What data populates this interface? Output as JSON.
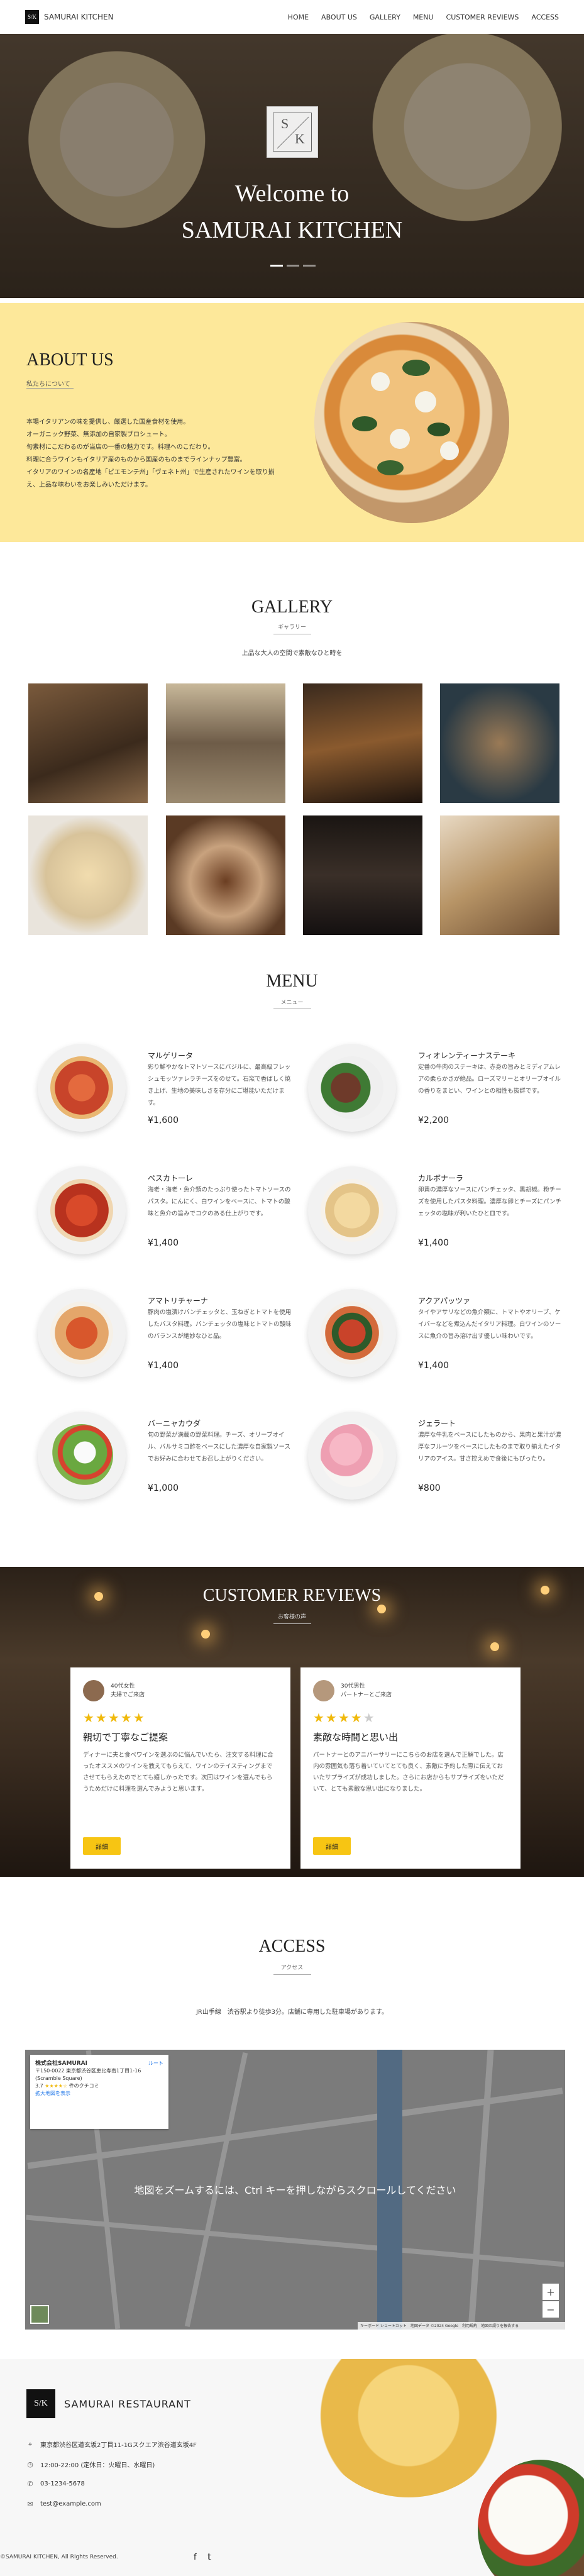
{
  "header": {
    "logo_text": "S/K",
    "brand": "SAMURAI KITCHEN",
    "nav": [
      "HOME",
      "ABOUT US",
      "GALLERY",
      "MENU",
      "CUSTOMER REVIEWS",
      "ACCESS"
    ]
  },
  "hero": {
    "emblem_s": "S",
    "emblem_k": "K",
    "title_line1": "Welcome to",
    "title_line2": "SAMURAI KITCHEN"
  },
  "about": {
    "title": "ABOUT US",
    "subtitle": "私たちについて",
    "paragraphs": [
      "本場イタリアンの味を提供し、厳選した国産食材を使用。",
      "オーガニック野菜、無添加の自家製ブロシュート。",
      "旬素材にこだわるのが当店の一番の魅力です。料理へのこだわり。",
      "料理に合うワインもイタリア産のものから国産のものまでラインナップ豊富。",
      "イタリアのワインの名産地「ピエモンテ州」「ヴェネト州」で生産されたワインを取り揃え、上品な味わいをお楽しみいただけます。"
    ]
  },
  "gallery": {
    "title": "GALLERY",
    "subtitle": "ギャラリー",
    "description": "上品な大人の空間で素敵なひと時を"
  },
  "menu": {
    "title": "MENU",
    "subtitle": "メニュー",
    "items": [
      {
        "name": "マルゲリータ",
        "desc": "彩り鮮やかなトマトソースにバジルに、最高級フレッシュモッツァレラチーズをのせて。石窯で香ばしく焼き上げ、生地の美味しさを存分にご堪能いただけます。",
        "price": "¥1,600"
      },
      {
        "name": "フィオレンティーナステーキ",
        "desc": "定番の牛肉のステーキは、赤身の旨みとミディアムレアの柔らかさが絶品。ローズマリーとオリーブオイルの香りをまとい、ワインとの相性も抜群です。",
        "price": "¥2,200"
      },
      {
        "name": "ペスカトーレ",
        "desc": "海老・海老・魚介類のたっぷり使ったトマトソースのパスタ。にんにく、白ワインをベースに、トマトの酸味と魚介の旨みでコクのある仕上がりです。",
        "price": "¥1,400"
      },
      {
        "name": "カルボナーラ",
        "desc": "卵黄の濃厚なソースにパンチェッタ、黒胡椒。粉チーズを使用したパスタ料理。濃厚な卵とチーズにパンチェッタの塩味が利いたひと皿です。",
        "price": "¥1,400"
      },
      {
        "name": "アマトリチャーナ",
        "desc": "豚肉の塩漬けパンチェッタと、玉ねぎとトマトを使用したパスタ料理。パンチェッタの塩味とトマトの酸味のバランスが絶妙なひと品。",
        "price": "¥1,400"
      },
      {
        "name": "アクアパッツァ",
        "desc": "タイやアサリなどの魚介類に、トマトやオリーブ、ケイパーなどを煮込んだイタリア料理。白ワインのソースに魚介の旨み溶け出す優しい味わいです。",
        "price": "¥1,400"
      },
      {
        "name": "バーニャカウダ",
        "desc": "旬の野菜が満載の野菜料理。チーズ、オリーブオイル、バルサミコ酢をベースにした濃厚な自家製ソースでお好みに合わせてお召し上がりください。",
        "price": "¥1,000"
      },
      {
        "name": "ジェラート",
        "desc": "濃厚な牛乳をベースにしたものから、果肉と果汁が濃厚なフルーツをベースにしたものまで取り揃えたイタリアのアイス。甘さ控えめで食後にもぴったり。",
        "price": "¥800"
      }
    ]
  },
  "reviews": {
    "title": "CUSTOMER REVIEWS",
    "subtitle": "お客様の声",
    "items": [
      {
        "age": "40代女性",
        "context": "夫婦でご来店",
        "stars": 5,
        "title": "親切で丁寧なご提案",
        "body": "ディナーに夫と食べワインを選ぶのに悩んでいたら、注文する料理に合ったオススメのワインを教えてもらえて、ワインのテイスティングまでさせてもらえたのでとても嬉しかったです。次回はワインを選んでもらうためだけに料理を選んでみようと思います。",
        "button": "詳細"
      },
      {
        "age": "30代男性",
        "context": "パートナーとご来店",
        "stars": 4,
        "title": "素敵な時間と思い出",
        "body": "パートナーとのアニバーサリーにこちらのお店を選んで正解でした。店内の雰囲気も落ち着いていてとても良く、素敵に予約した際に伝えておいたサプライズが成功しました。さらにお店からもサプライズをいただいて、とても素敵な思い出になりました。",
        "button": "詳細"
      }
    ]
  },
  "access": {
    "title": "ACCESS",
    "subtitle": "アクセス",
    "address_line": "JR山手線　渋谷駅より徒歩3分。店舗に専用した駐車場があります。",
    "map": {
      "card_name": "株式会社SAMURAI",
      "card_address": "〒150-0022 東京都渋谷区恵比寿南1丁目1-16 (Scramble Square)",
      "card_rating": "3.7",
      "card_reviews": "件のクチコミ",
      "card_link": "拡大地図を表示",
      "card_route": "ルート",
      "overlay_message": "地図をズームするには、Ctrl キーを押しながらスクロールしてください",
      "attribution": "キーボード ショートカット　地図データ ©2024 Google　利用規約　地図の誤りを報告する"
    }
  },
  "footer": {
    "logo": "S/K",
    "name": "SAMURAI RESTAURANT",
    "address": "東京都渋谷区道玄坂2丁目11-1Gスクエア渋谷道玄坂4F",
    "hours": "12:00-22:00 (定休日：火曜日、水曜日)",
    "phone": "03-1234-5678",
    "email": "test@example.com",
    "copyright": "©SAMURAI KITCHEN, All Rights Reserved.",
    "icons": {
      "address": "pin-icon",
      "hours": "clock-icon",
      "phone": "phone-icon",
      "email": "mail-icon",
      "facebook": "facebook-icon",
      "twitter": "twitter-icon"
    }
  }
}
